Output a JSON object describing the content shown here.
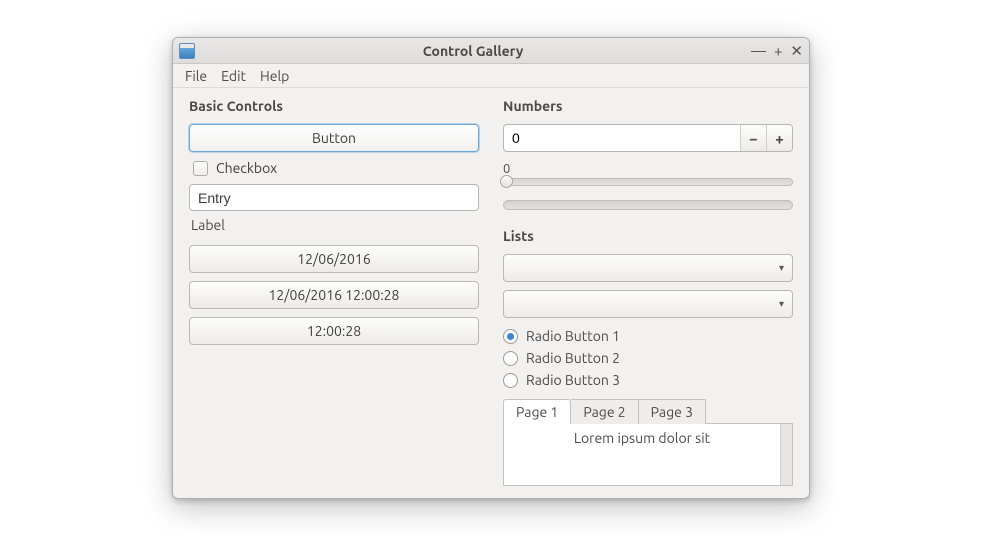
{
  "window": {
    "title": "Control Gallery"
  },
  "menu": {
    "file": "File",
    "edit": "Edit",
    "help": "Help"
  },
  "basic": {
    "title": "Basic Controls",
    "button_label": "Button",
    "checkbox_label": "Checkbox",
    "entry_value": "Entry",
    "label_text": "Label",
    "date_button": "12/06/2016",
    "datetime_button": "12/06/2016 12:00:28",
    "time_button": "12:00:28"
  },
  "numbers": {
    "title": "Numbers",
    "spin_value": "0",
    "slider_value_label": "0"
  },
  "lists": {
    "title": "Lists",
    "radios": [
      {
        "label": "Radio Button 1",
        "checked": true
      },
      {
        "label": "Radio Button 2",
        "checked": false
      },
      {
        "label": "Radio Button 3",
        "checked": false
      }
    ],
    "tabs": [
      "Page 1",
      "Page 2",
      "Page 3"
    ],
    "tab_content": "Lorem ipsum dolor sit"
  }
}
